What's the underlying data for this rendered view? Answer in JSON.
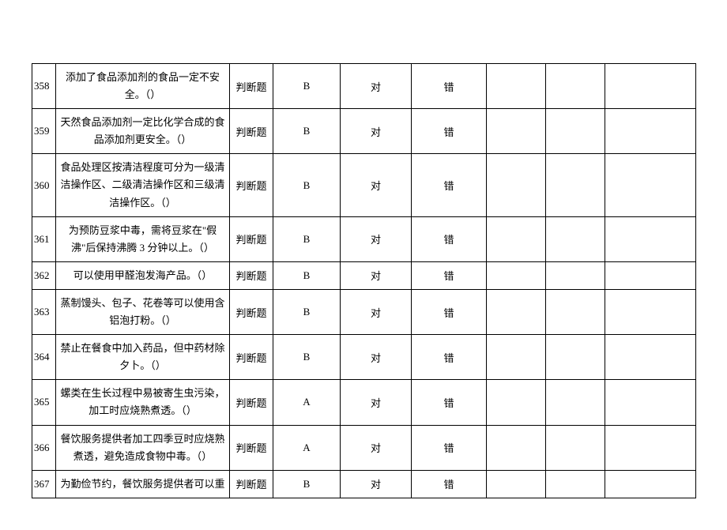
{
  "rows": [
    {
      "num": "358",
      "question": "添加了食品添加剂的食品一定不安全。（）",
      "type": "判断题",
      "answer": "B",
      "opt1": "对",
      "opt2": "错"
    },
    {
      "num": "359",
      "question": "天然食品添加剂一定比化学合成的食品添加剂更安全。（）",
      "type": "判断题",
      "answer": "B",
      "opt1": "对",
      "opt2": "错"
    },
    {
      "num": "360",
      "question": "食品处理区按清洁程度可分为一级清洁操作区、二级清洁操作区和三级清洁操作区。（）",
      "type": "判断题",
      "answer": "B",
      "opt1": "对",
      "opt2": "错"
    },
    {
      "num": "361",
      "question": "为预防豆浆中毒，需将豆浆在\"假沸\"后保持沸腾 3 分钟以上。（）",
      "type": "判断题",
      "answer": "B",
      "opt1": "对",
      "opt2": "错"
    },
    {
      "num": "362",
      "question": "可以使用甲醛泡发海产品。（）",
      "type": "判断题",
      "answer": "B",
      "opt1": "对",
      "opt2": "错"
    },
    {
      "num": "363",
      "question": "蒸制馒头、包子、花卷等可以使用含铝泡打粉。（）",
      "type": "判断题",
      "answer": "B",
      "opt1": "对",
      "opt2": "错"
    },
    {
      "num": "364",
      "question": "禁止在餐食中加入药品，但中药材除夕卜。（）",
      "type": "判断题",
      "answer": "B",
      "opt1": "对",
      "opt2": "错"
    },
    {
      "num": "365",
      "question": "螺类在生长过程中易被寄生虫污染，加工时应烧熟煮透。（）",
      "type": "判断题",
      "answer": "A",
      "opt1": "对",
      "opt2": "错"
    },
    {
      "num": "366",
      "question": "餐饮服务提供者加工四季豆时应烧熟煮透，避免造成食物中毒。（）",
      "type": "判断题",
      "answer": "A",
      "opt1": "对",
      "opt2": "错"
    },
    {
      "num": "367",
      "question": "为勤俭节约，餐饮服务提供者可以重",
      "type": "判断题",
      "answer": "B",
      "opt1": "对",
      "opt2": "错"
    }
  ]
}
